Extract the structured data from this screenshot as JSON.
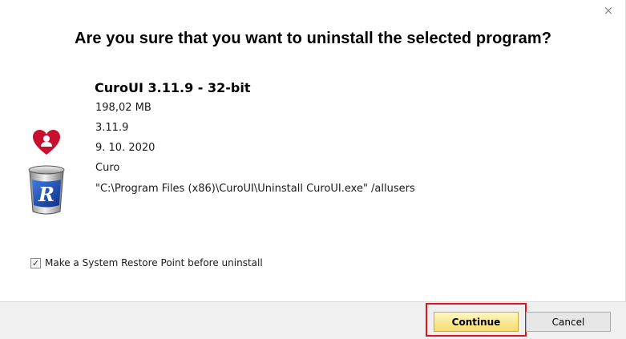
{
  "dialog": {
    "close_glyph": "×",
    "headline": "Are you sure that you want to uninstall the selected program?"
  },
  "program": {
    "name": "CuroUI 3.11.9 - 32-bit",
    "size": "198,02 MB",
    "version": "3.11.9",
    "install_date": "9. 10. 2020",
    "publisher": "Curo",
    "uninstall_command": "\"C:\\Program Files (x86)\\CuroUI\\Uninstall CuroUI.exe\" /allusers"
  },
  "options": {
    "restore_point_label": "Make a System Restore Point before uninstall",
    "restore_point_checked": true,
    "check_glyph": "✓"
  },
  "buttons": {
    "continue_label": "Continue",
    "cancel_label": "Cancel"
  },
  "colors": {
    "heart": "#c8102e",
    "highlight": "#e0141a",
    "continue_fill": "#f7dc6b",
    "trash_label": "#1f4ea8"
  },
  "icons": [
    "heart-user-icon",
    "recycle-bin-icon",
    "close-icon",
    "checkmark-icon"
  ]
}
